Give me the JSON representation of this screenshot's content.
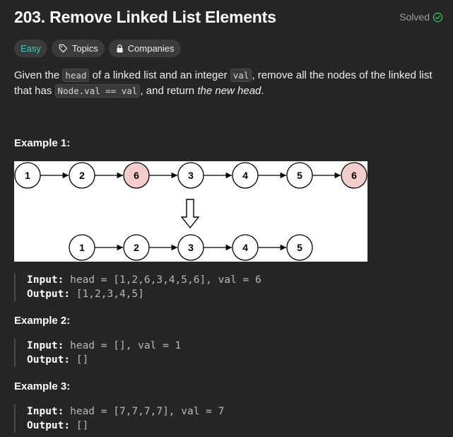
{
  "header": {
    "title": "203. Remove Linked List Elements",
    "solved_label": "Solved"
  },
  "tags": {
    "difficulty": "Easy",
    "topics": "Topics",
    "companies": "Companies"
  },
  "description": {
    "p1": "Given the ",
    "code_head": "head",
    "p2": " of a linked list and an integer ",
    "code_val": "val",
    "p3": ", remove all the nodes of the linked list that has ",
    "code_expr": "Node.val == val",
    "p4": ", and return ",
    "emph": "the new head",
    "p5": "."
  },
  "examples": [
    {
      "title": "Example 1:",
      "input_label": "Input:",
      "input_value": " head = [1,2,6,3,4,5,6], val = 6",
      "output_label": "Output:",
      "output_value": " [1,2,3,4,5]"
    },
    {
      "title": "Example 2:",
      "input_label": "Input:",
      "input_value": " head = [], val = 1",
      "output_label": "Output:",
      "output_value": " []"
    },
    {
      "title": "Example 3:",
      "input_label": "Input:",
      "input_value": " head = [7,7,7,7], val = 7",
      "output_label": "Output:",
      "output_value": " []"
    }
  ],
  "diagram": {
    "top_row": [
      "1",
      "2",
      "6",
      "3",
      "4",
      "5",
      "6"
    ],
    "top_removed": [
      false,
      false,
      true,
      false,
      false,
      false,
      true
    ],
    "bottom_row": [
      "1",
      "2",
      "3",
      "4",
      "5"
    ],
    "removed_color": "#f4cccc",
    "node_color": "#ffffff"
  },
  "colors": {
    "easy": "#46c6c2",
    "solved_check": "#2cbb5d",
    "background": "#262626"
  }
}
